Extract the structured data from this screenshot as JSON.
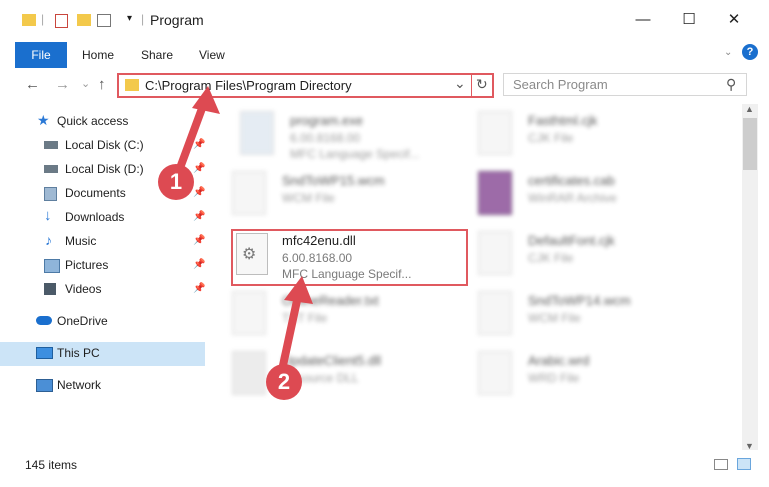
{
  "window": {
    "title": "Program",
    "controls": {
      "minimize": "—",
      "maximize": "☐",
      "close": "✕"
    }
  },
  "ribbon": {
    "tabs": [
      "File",
      "Home",
      "Share",
      "View"
    ],
    "help": "?"
  },
  "address": {
    "path": "C:\\Program Files\\Program Directory",
    "refresh": "↻",
    "dropdown": "⌄"
  },
  "search": {
    "placeholder": "Search Program",
    "icon": "⚲"
  },
  "nav": {
    "back": "←",
    "forward": "→",
    "recent": "⌄",
    "up": "↑"
  },
  "sidebar": {
    "items": [
      {
        "label": "Quick access",
        "icon": "star-icon",
        "color": "#2b79d6"
      },
      {
        "label": "Local Disk (C:)",
        "icon": "drive-icon",
        "pinned": true
      },
      {
        "label": "Local Disk (D:)",
        "icon": "drive-icon",
        "pinned": true
      },
      {
        "label": "Documents",
        "icon": "documents-icon",
        "pinned": true
      },
      {
        "label": "Downloads",
        "icon": "download-icon",
        "pinned": true
      },
      {
        "label": "Music",
        "icon": "music-icon",
        "pinned": true
      },
      {
        "label": "Pictures",
        "icon": "pictures-icon",
        "pinned": true
      },
      {
        "label": "Videos",
        "icon": "videos-icon",
        "pinned": true
      },
      {
        "label": "OneDrive",
        "icon": "onedrive-icon"
      },
      {
        "label": "This PC",
        "icon": "computer-icon",
        "selected": true
      },
      {
        "label": "Network",
        "icon": "network-icon"
      }
    ]
  },
  "files": [
    {
      "name": "program.exe",
      "line1": "6.00.8168.00",
      "line2": "MFC Language Specif..."
    },
    {
      "name": "Fasthtml.cjk",
      "line1": "CJK File",
      "line2": ""
    },
    {
      "name": "SndToWP15.wcm",
      "line1": "WCM File",
      "line2": ""
    },
    {
      "name": "certificates.cab",
      "line1": "WinRAR Archive",
      "line2": ""
    },
    {
      "name": "mfc42enu.dll",
      "line1": "6.00.8168.00",
      "line2": "MFC Language Specif..."
    },
    {
      "name": "DefaultFont.cjk",
      "line1": "CJK File",
      "line2": ""
    },
    {
      "name": "OfflineReader.txt",
      "line1": "TXT File",
      "line2": ""
    },
    {
      "name": "SndToWP14.wcm",
      "line1": "WCM File",
      "line2": ""
    },
    {
      "name": "UpdateClient5.dll",
      "line1": "Resource DLL",
      "line2": ""
    },
    {
      "name": "Arabic.wrd",
      "line1": "WRD File",
      "line2": ""
    }
  ],
  "status": {
    "count": "145 items"
  },
  "callouts": [
    "1",
    "2"
  ],
  "colors": {
    "accent": "#1a6fce",
    "highlight": "#e0595f",
    "selected_bg": "#cce4f7"
  }
}
